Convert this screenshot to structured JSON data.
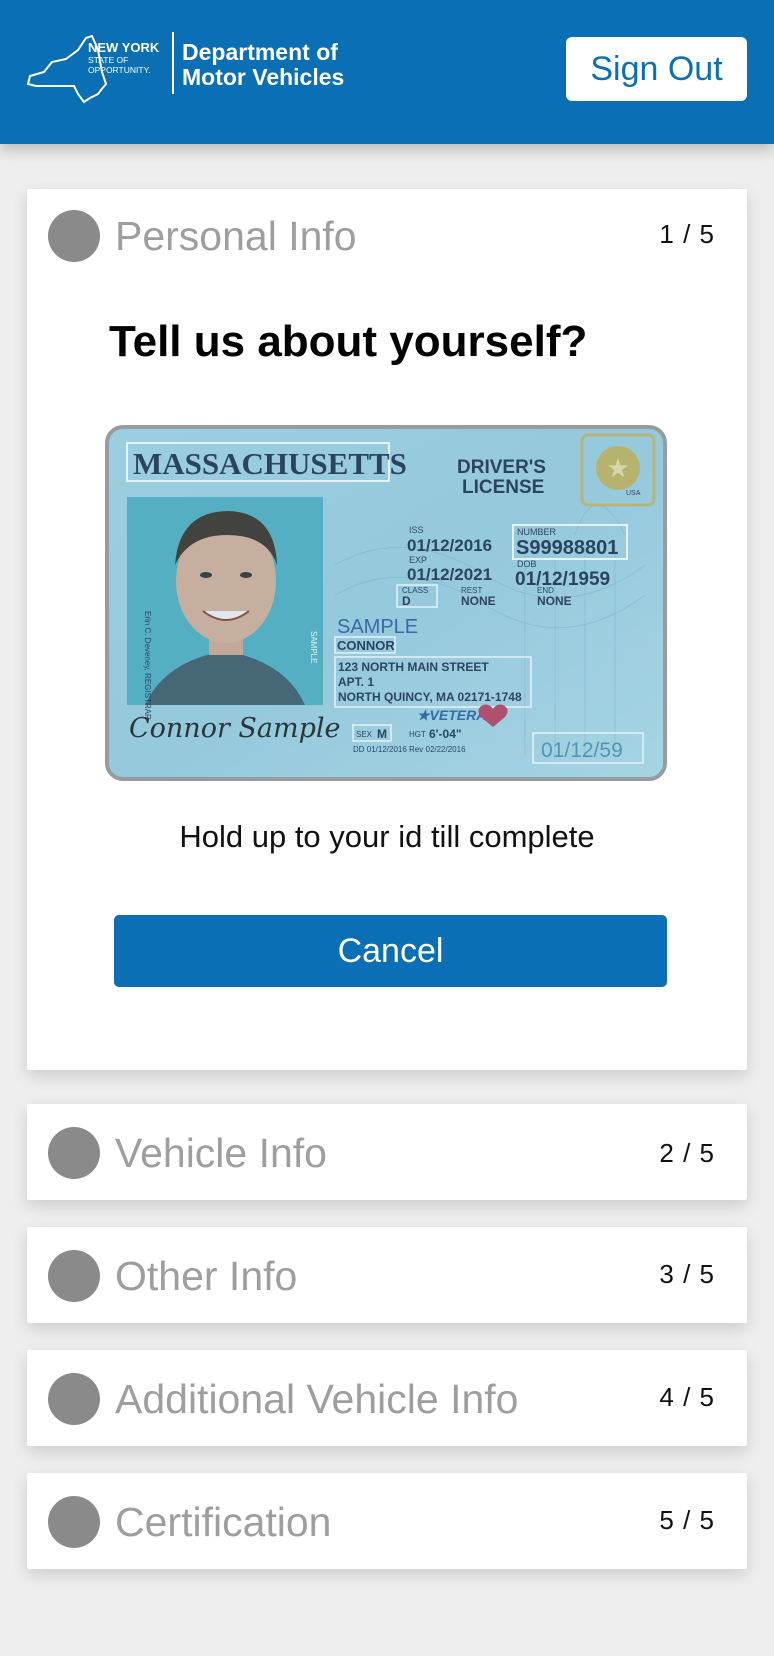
{
  "header": {
    "logo_ny_line1": "NEW YORK",
    "logo_ny_line2": "STATE OF",
    "logo_ny_line3": "OPPORTUNITY.",
    "logo_dept_line1": "Department of",
    "logo_dept_line2": "Motor Vehicles",
    "signout_label": "Sign Out",
    "brand_color": "#0a6fb5"
  },
  "steps": [
    {
      "title": "Personal Info",
      "count": "1 / 5"
    },
    {
      "title": "Vehicle Info",
      "count": "2 / 5"
    },
    {
      "title": "Other Info",
      "count": "3 / 5"
    },
    {
      "title": "Additional Vehicle Info",
      "count": "4 / 5"
    },
    {
      "title": "Certification",
      "count": "5 / 5"
    }
  ],
  "personal": {
    "question": "Tell us about yourself?",
    "hint": "Hold up to your id till complete",
    "cancel_label": "Cancel"
  },
  "license": {
    "state": "MASSACHUSETTS",
    "type_line1": "DRIVER'S",
    "type_line2": "LICENSE",
    "iss_label": "ISS",
    "iss": "01/12/2016",
    "exp_label": "EXP",
    "exp": "01/12/2021",
    "number_label": "NUMBER",
    "number": "S99988801",
    "dob_label": "DOB",
    "dob": "01/12/1959",
    "class_label": "CLASS",
    "class_value": "D",
    "rest_label": "REST",
    "rest": "NONE",
    "end_label": "END",
    "end": "NONE",
    "last_name": "SAMPLE",
    "first_name": "CONNOR",
    "addr1": "123 NORTH MAIN STREET",
    "addr2": "APT. 1",
    "addr3": "NORTH QUINCY, MA 02171-1748",
    "veteran": "★VETERAN",
    "sex_label": "SEX",
    "sex": "M",
    "hgt_label": "HGT",
    "hgt": "6'-04\"",
    "dd": "DD 01/12/2016 Rev 02/22/2016",
    "ghost_dob": "01/12/59",
    "signature": "Connor Sample",
    "usa": "USA",
    "sample_vertical": "SAMPLE",
    "registrar": "Erin C. Deveney, REGISTRAR"
  }
}
